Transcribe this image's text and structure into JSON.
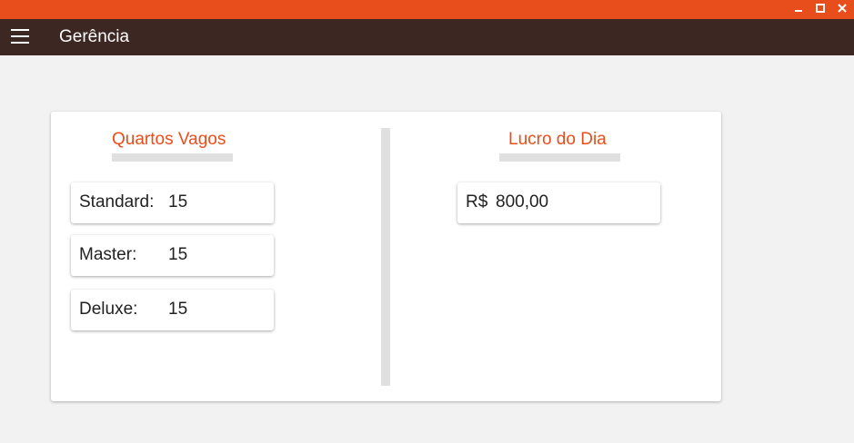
{
  "window": {
    "controls": {
      "minimize_icon": "minimize-icon",
      "maximize_icon": "maximize-icon",
      "close_icon": "close-icon"
    },
    "titlebar_color": "#e84e1b"
  },
  "appbar": {
    "menu_icon": "hamburger-menu-icon",
    "title": "Gerência",
    "background": "#3d2723"
  },
  "vacant_rooms": {
    "title": "Quartos Vagos",
    "items": [
      {
        "label": "Standard:",
        "value": "15"
      },
      {
        "label": "Master:",
        "value": "15"
      },
      {
        "label": "Deluxe:",
        "value": "15"
      }
    ]
  },
  "daily_profit": {
    "title": "Lucro do Dia",
    "currency": "R$",
    "value": "800,00"
  },
  "accent_color": "#e84e1b"
}
